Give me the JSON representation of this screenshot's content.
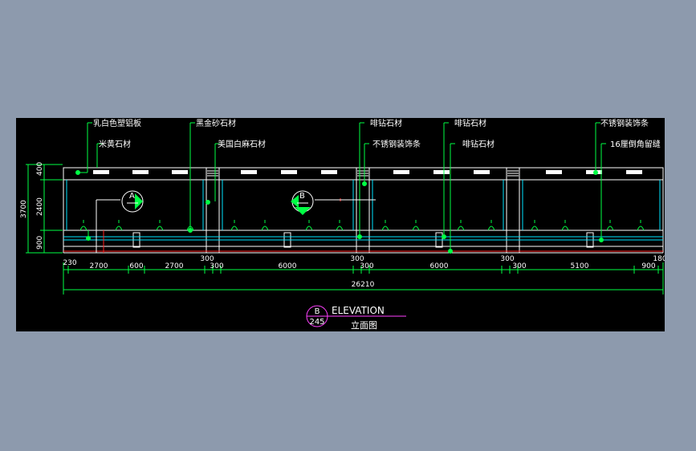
{
  "drawing": {
    "colors": {
      "background": "#000000",
      "frame": "#8d9aad",
      "outline": "#ffffff",
      "leader": "#00ff44",
      "dimension": "#00ff44",
      "section_marker": "#00ff44",
      "structure": "#00e5ff",
      "accent": "#ff2020",
      "title": "#ff40ff"
    },
    "callouts_top": [
      "乳白色塑铝板",
      "黑金砂石材",
      "啡钻石材",
      "啡钻石材",
      "不锈钢装饰条"
    ],
    "callouts_bottom": [
      "米黄石材",
      "美国白麻石材",
      "不锈钢装饰条",
      "啡钻石材",
      "16厘倒角留缝"
    ],
    "section_markers": [
      "A",
      "B"
    ],
    "vertical_dims": [
      "400",
      "2400",
      "900",
      "3700"
    ],
    "horizontal_dims": [
      "230",
      "2700",
      "600",
      "2700",
      "300",
      "300",
      "6000",
      "300",
      "300",
      "6000",
      "300",
      "300",
      "5100",
      "900",
      "180"
    ],
    "overall_dim": "26210",
    "title": {
      "bubble_top": "B",
      "bubble_bottom": "245",
      "label": "ELEVATION",
      "subtitle": "立面图"
    }
  }
}
